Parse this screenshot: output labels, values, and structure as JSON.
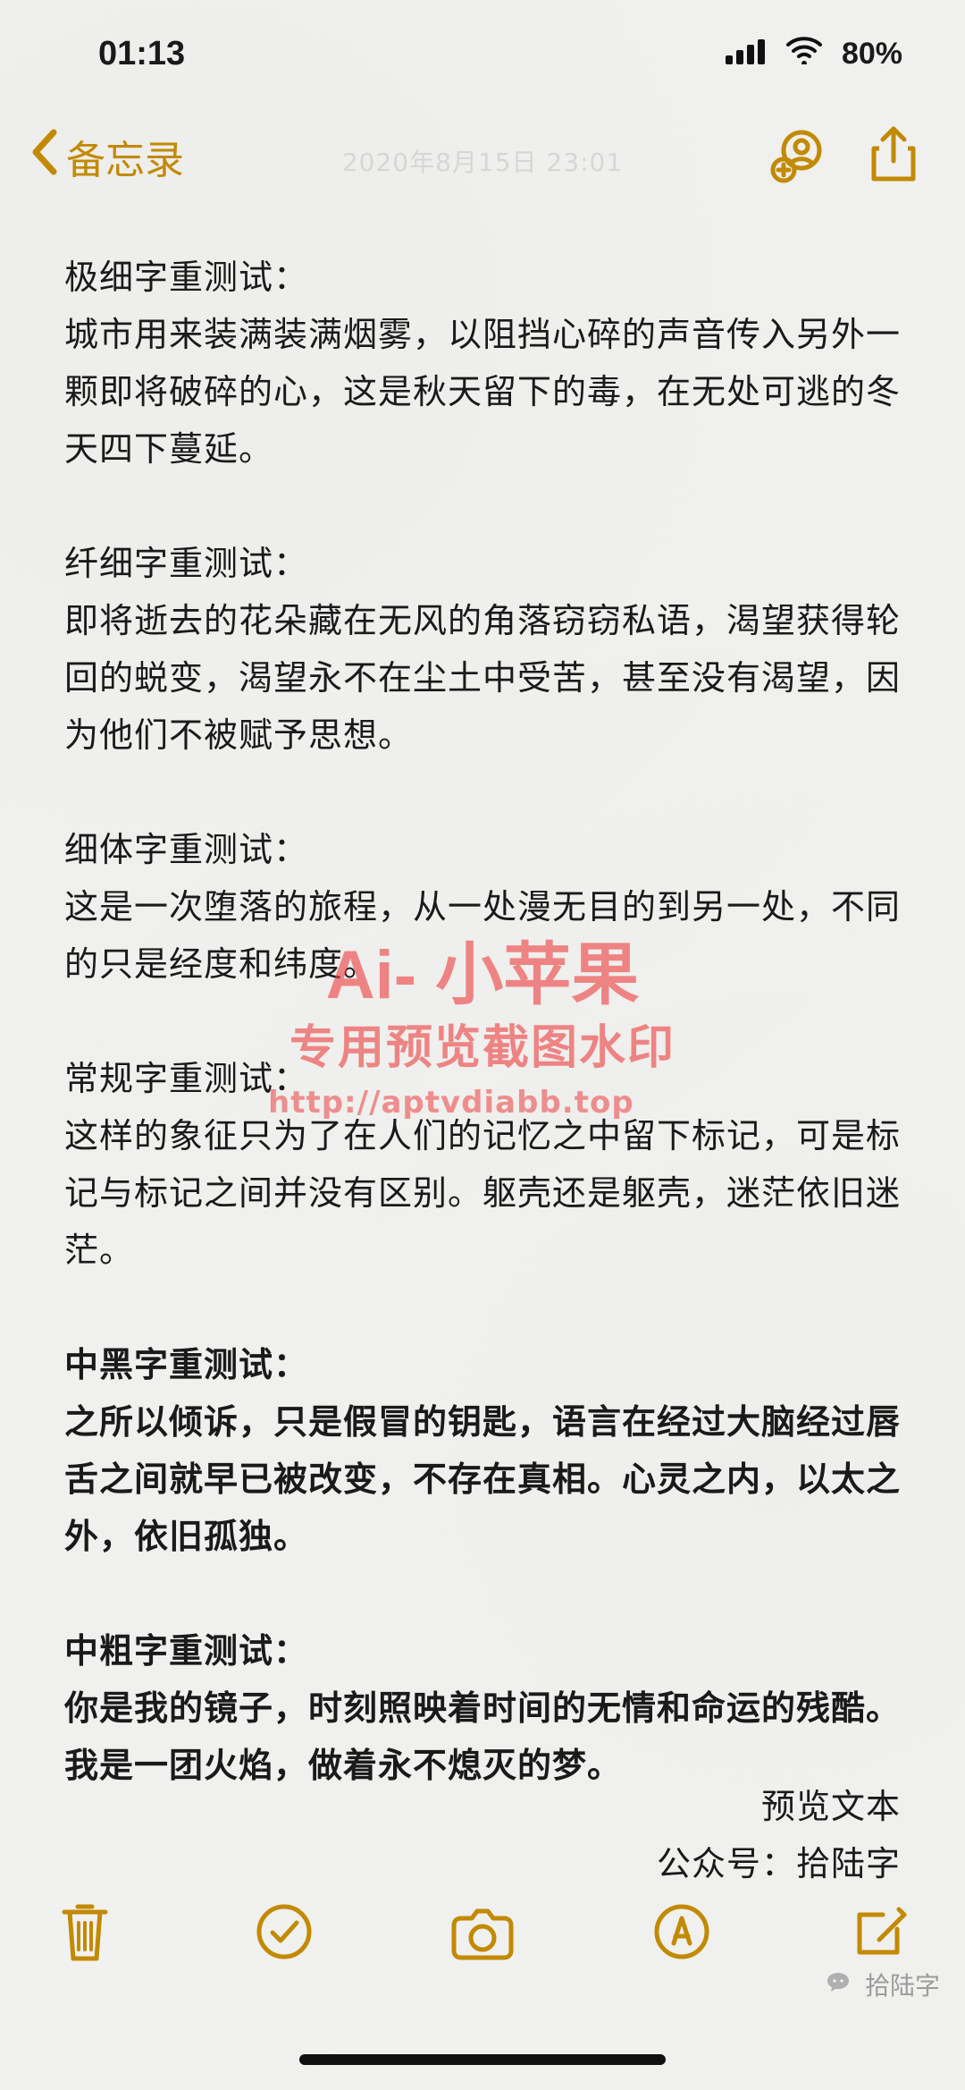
{
  "status_bar": {
    "time": "01:13",
    "battery": "80%",
    "icons": {
      "signal": "cellular-signal-icon",
      "wifi": "wifi-icon",
      "battery": "battery-icon"
    }
  },
  "nav": {
    "back_label": "备忘录",
    "date": "2020年8月15日 23:01",
    "actions": {
      "collaborate_icon": "add-person-icon",
      "share_icon": "share-icon"
    }
  },
  "note": {
    "sections": [
      {
        "heading": "极细字重测试：",
        "body": "城市用来装满装满烟雾，以阻挡心碎的声音传入另外一颗即将破碎的心，这是秋天留下的毒，在无处可逃的冬天四下蔓延。"
      },
      {
        "heading": "纤细字重测试：",
        "body": "即将逝去的花朵藏在无风的角落窃窃私语，渴望获得轮回的蜕变，渴望永不在尘土中受苦，甚至没有渴望，因为他们不被赋予思想。"
      },
      {
        "heading": "细体字重测试：",
        "body": "这是一次堕落的旅程，从一处漫无目的到另一处，不同的只是经度和纬度。"
      },
      {
        "heading": "常规字重测试：",
        "body": "这样的象征只为了在人们的记忆之中留下标记，可是标记与标记之间并没有区别。躯壳还是躯壳，迷茫依旧迷茫。"
      },
      {
        "heading": "中黑字重测试：",
        "body": "之所以倾诉，只是假冒的钥匙，语言在经过大脑经过唇舌之间就早已被改变，不存在真相。心灵之内，以太之外，依旧孤独。"
      },
      {
        "heading": "中粗字重测试：",
        "body": "你是我的镜子，时刻照映着时间的无情和命运的残酷。我是一团火焰，做着永不熄灭的梦。"
      }
    ],
    "signature": {
      "line1": "预览文本",
      "line2": "公众号：拾陆字"
    }
  },
  "watermark": {
    "line1": "Ai- 小苹果",
    "line2": "专用预览截图水印",
    "line3": "http://aptvdiabb.top"
  },
  "toolbar": {
    "delete_icon": "trash-icon",
    "checklist_icon": "check-circle-icon",
    "camera_icon": "camera-icon",
    "markup_icon": "markup-pen-icon",
    "compose_icon": "compose-icon"
  },
  "footer": {
    "wechat_label": "拾陆字",
    "wechat_icon": "wechat-icon"
  },
  "colors": {
    "accent": "#c28a00",
    "text": "#1a1a1a",
    "background": "#f4f4f2",
    "watermark": "#eb4242"
  }
}
